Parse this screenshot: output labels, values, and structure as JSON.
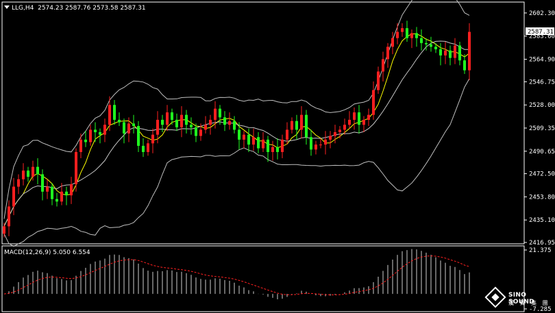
{
  "header": {
    "symbol": "LLG,H4",
    "ohlc": "2574.23 2587.76 2573.58 2587.31"
  },
  "macd": {
    "label": "MACD(12,26,9)",
    "values": "5.050 6.554",
    "scale_max": "21.375",
    "scale_min": "-7.285"
  },
  "logo": {
    "brand": "SINO SOUND",
    "sub": "漢 聲 集 團"
  },
  "colors": {
    "background": "#000000",
    "bull": "#1fff1f",
    "bear": "#ff1f1f",
    "frame": "#ffffff",
    "ma_fast": "#ffff00",
    "band": "#c0c0c0",
    "signal": "#ff2020"
  },
  "chart_data": [
    {
      "type": "candlestick",
      "title": "LLG,H4",
      "ylim": [
        2416.95,
        2610.0
      ],
      "y_ticks": [
        "2602.30",
        "2583.60",
        "2564.90",
        "2546.75",
        "2528.00",
        "2509.35",
        "2490.65",
        "2472.50",
        "2453.80",
        "2435.10",
        "2416.95"
      ],
      "current_price": "2587.31",
      "close": [
        2430,
        2446,
        2462,
        2468,
        2475,
        2470,
        2478,
        2472,
        2458,
        2462,
        2452,
        2450,
        2458,
        2455,
        2464,
        2490,
        2500,
        2498,
        2508,
        2506,
        2504,
        2512,
        2528,
        2516,
        2514,
        2505,
        2513,
        2511,
        2495,
        2490,
        2497,
        2504,
        2516,
        2512,
        2522,
        2516,
        2510,
        2520,
        2512,
        2510,
        2503,
        2508,
        2512,
        2516,
        2525,
        2518,
        2512,
        2515,
        2508,
        2500,
        2504,
        2496,
        2502,
        2493,
        2500,
        2490,
        2494,
        2490,
        2500,
        2508,
        2515,
        2508,
        2520,
        2502,
        2492,
        2496,
        2496,
        2500,
        2503,
        2506,
        2508,
        2512,
        2516,
        2522,
        2512,
        2516,
        2520,
        2540,
        2555,
        2565,
        2575,
        2582,
        2587,
        2590,
        2582,
        2586,
        2582,
        2578,
        2577,
        2575,
        2573,
        2568,
        2572,
        2566,
        2576,
        2564,
        2556,
        2587
      ],
      "series": [
        {
          "name": "",
          "kind": "moving-average",
          "color": "#ffff00"
        },
        {
          "name": "",
          "kind": "moving-average",
          "color": "#c8c8c8"
        },
        {
          "name": "",
          "kind": "bollinger-upper",
          "color": "#c0c0c0"
        },
        {
          "name": "",
          "kind": "bollinger-lower",
          "color": "#c0c0c0"
        }
      ]
    },
    {
      "type": "bar",
      "title": "MACD(12,26,9)",
      "ylim": [
        -7.285,
        21.375
      ],
      "values_label": "5.050 6.554",
      "series": [
        {
          "name": "",
          "kind": "histogram",
          "color": "#d0d0d0"
        },
        {
          "name": "",
          "kind": "signal",
          "color": "#ff2020"
        }
      ]
    }
  ]
}
